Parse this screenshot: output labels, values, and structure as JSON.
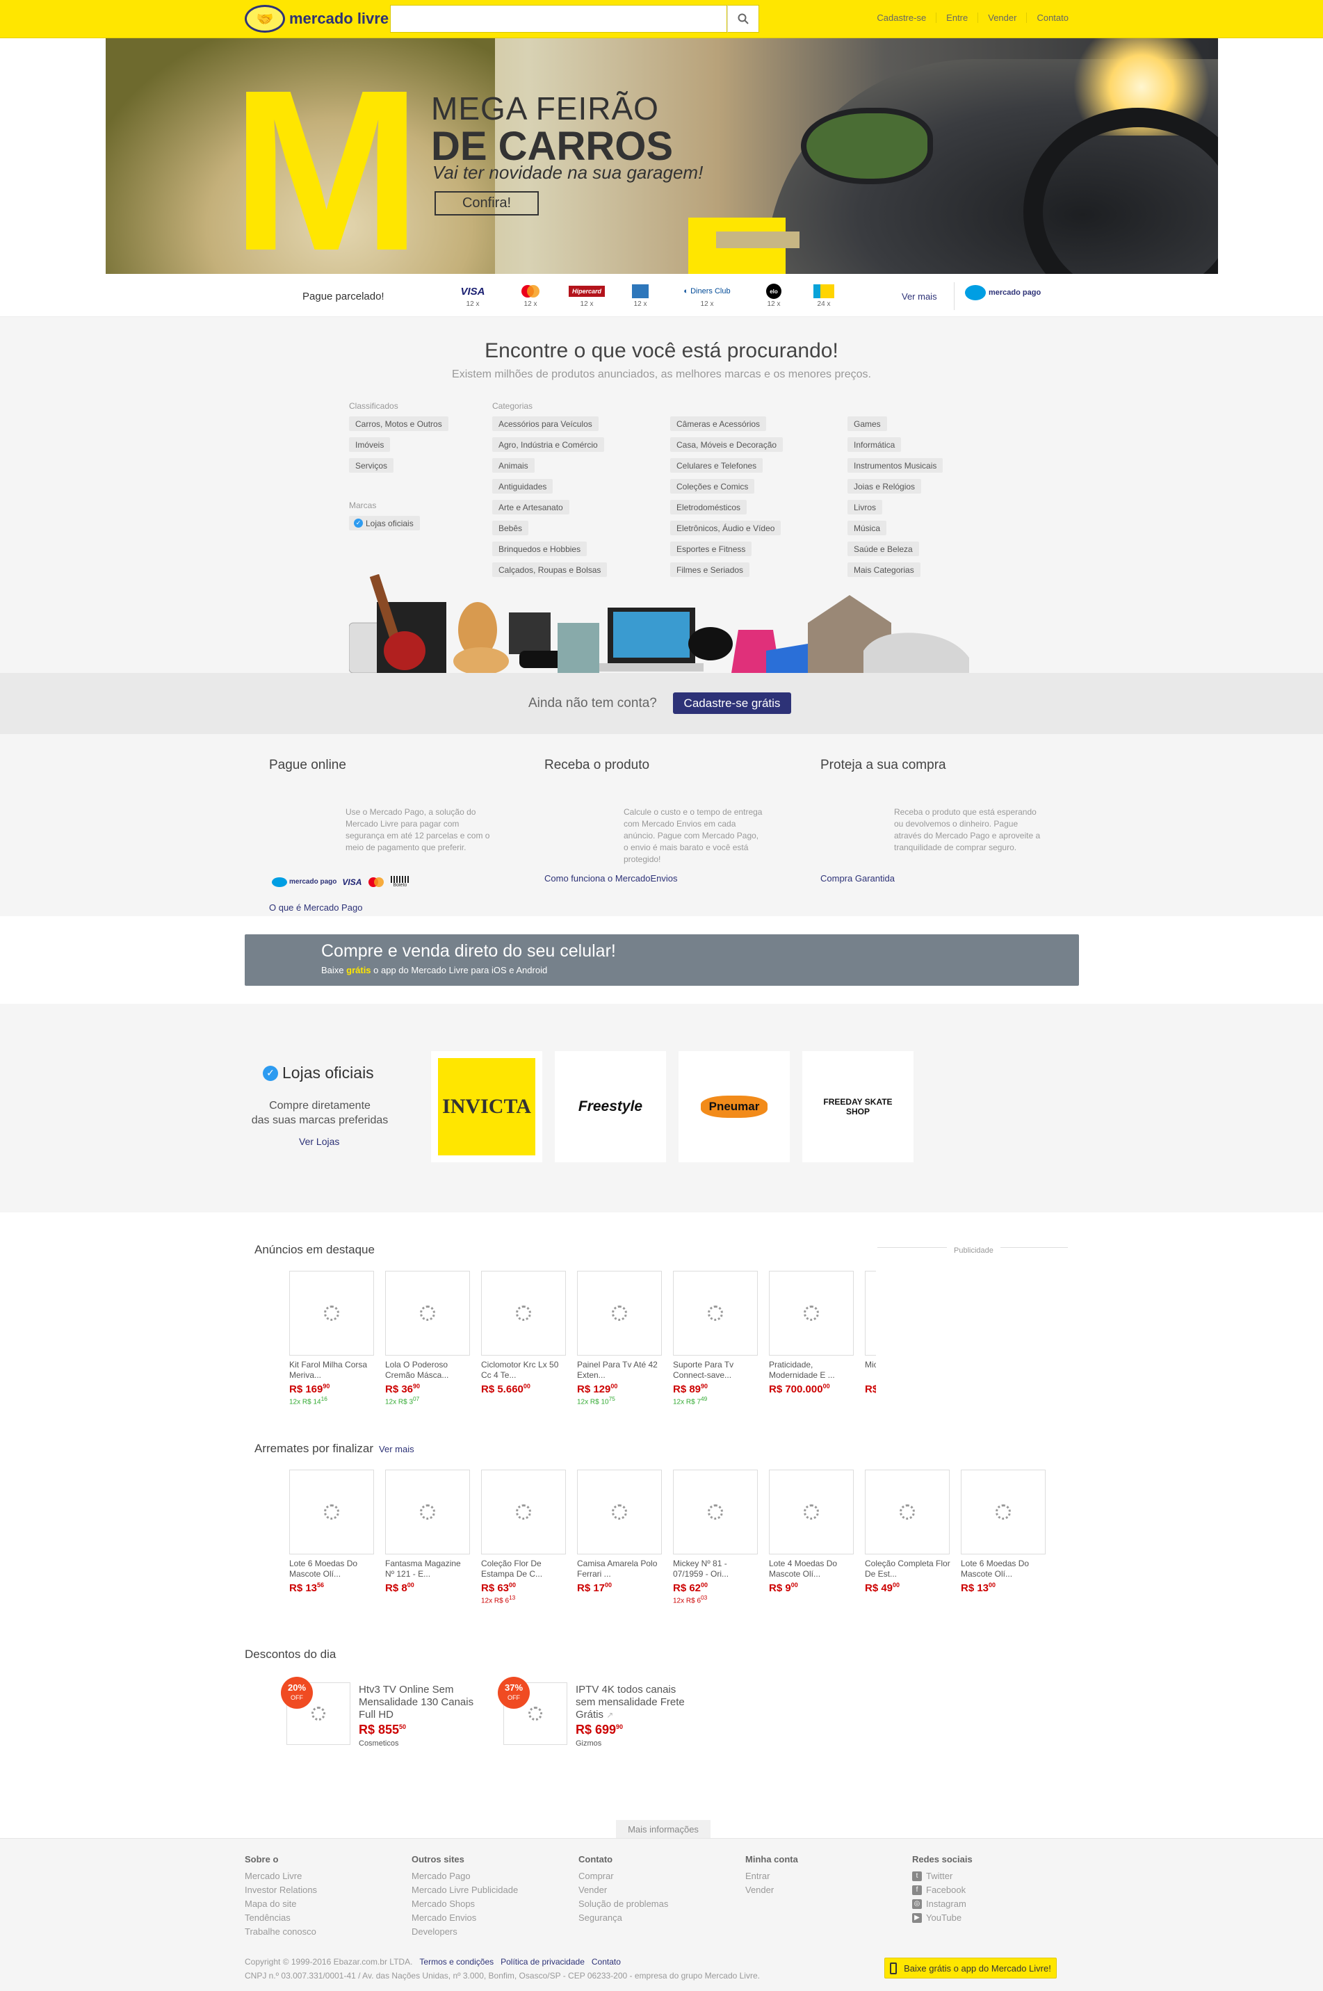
{
  "header": {
    "logo_text": "mercado livre",
    "search_placeholder": "",
    "nav": [
      "Cadastre-se",
      "Entre",
      "Vender",
      "Contato"
    ]
  },
  "banner": {
    "title1": "MEGA FEIRÃO",
    "title2": "DE CARROS",
    "subtitle": "Vai ter novidade na sua garagem!",
    "cta": "Confira!"
  },
  "payment": {
    "label": "Pague parcelado!",
    "cards": [
      {
        "name": "VISA",
        "installments": "12 x"
      },
      {
        "name": "mastercard",
        "installments": "12 x"
      },
      {
        "name": "Hipercard",
        "installments": "12 x"
      },
      {
        "name": "amex",
        "installments": "12 x"
      },
      {
        "name": "Diners Club",
        "installments": "12 x"
      },
      {
        "name": "elo",
        "installments": "12 x"
      },
      {
        "name": "card",
        "installments": "24 x"
      }
    ],
    "more": "Ver mais",
    "mp": "mercado pago"
  },
  "categories": {
    "title": "Encontre o que você está procurando!",
    "subtitle": "Existem milhões de produtos anunciados, as melhores marcas e os menores preços.",
    "classificados_title": "Classificados",
    "classificados": [
      "Carros, Motos e Outros",
      "Imóveis",
      "Serviços"
    ],
    "marcas_title": "Marcas",
    "marcas": [
      "Lojas oficiais"
    ],
    "categorias_title": "Categorias",
    "col1": [
      "Acessórios para Veículos",
      "Agro, Indústria e Comércio",
      "Animais",
      "Antiguidades",
      "Arte e Artesanato",
      "Bebês",
      "Brinquedos e Hobbies",
      "Calçados, Roupas e Bolsas"
    ],
    "col2": [
      "Câmeras e Acessórios",
      "Casa, Móveis e Decoração",
      "Celulares e Telefones",
      "Coleções e Comics",
      "Eletrodomésticos",
      "Eletrônicos, Áudio e Vídeo",
      "Esportes e Fitness",
      "Filmes e Seriados"
    ],
    "col3": [
      "Games",
      "Informática",
      "Instrumentos Musicais",
      "Joias e Relógios",
      "Livros",
      "Música",
      "Saúde e Beleza",
      "Mais Categorias"
    ]
  },
  "signup": {
    "question": "Ainda não tem conta?",
    "button": "Cadastre-se grátis"
  },
  "features": [
    {
      "title": "Pague online",
      "text": "Use o Mercado Pago, a solução do Mercado Livre para pagar com segurança em até 12 parcelas e com o meio de pagamento que preferir.",
      "link": "O que é Mercado Pago"
    },
    {
      "title": "Receba o produto",
      "text": "Calcule o custo e o tempo de entrega com Mercado Envios em cada anúncio. Pague com Mercado Pago, o envio é mais barato e você está protegido!",
      "link": "Como funciona o MercadoEnvios"
    },
    {
      "title": "Proteja a sua compra",
      "text": "Receba o produto que está esperando ou devolvemos o dinheiro. Pague através do Mercado Pago e aproveite a tranquilidade de comprar seguro.",
      "link": "Compra Garantida"
    }
  ],
  "feature_logos": {
    "mp": "mercado pago",
    "visa": "VISA",
    "boleto": "Boleto"
  },
  "app": {
    "title": "Compre e venda direto do seu celular!",
    "pre": "Baixe ",
    "free": "grátis",
    "post": " o app do Mercado Livre para iOS e Android"
  },
  "stores": {
    "title": "Lojas oficiais",
    "desc1": "Compre diretamente",
    "desc2": "das suas marcas preferidas",
    "link": "Ver Lojas",
    "brands": [
      "INVICTA",
      "Freestyle",
      "Pneumar",
      "FREEDAY SKATE SHOP"
    ]
  },
  "featured": {
    "title": "Anúncios em destaque",
    "pub": "Publicidade",
    "items": [
      {
        "name": "Kit Farol Milha Corsa Meriva...",
        "price": "R$ 169",
        "cents": "90",
        "inst": "12x R$ 14",
        "ic": "16"
      },
      {
        "name": "Lola O Poderoso Cremão Másca...",
        "price": "R$ 36",
        "cents": "90",
        "inst": "12x R$ 3",
        "ic": "07"
      },
      {
        "name": "Ciclomotor Krc Lx 50 Cc 4 Te...",
        "price": "R$ 5.660",
        "cents": "00",
        "inst": "",
        "ic": ""
      },
      {
        "name": "Painel Para Tv Até 42 Exten...",
        "price": "R$ 129",
        "cents": "00",
        "inst": "12x R$ 10",
        "ic": "75"
      },
      {
        "name": "Suporte Para Tv Connect-save...",
        "price": "R$ 89",
        "cents": "90",
        "inst": "12x R$ 7",
        "ic": "49"
      },
      {
        "name": "Praticidade, Modernidade E ...",
        "price": "R$ 700.000",
        "cents": "00",
        "inst": "",
        "ic": ""
      },
      {
        "name": "Mic Us...",
        "price": "R$",
        "cents": "",
        "inst": "",
        "ic": ""
      }
    ]
  },
  "auctions": {
    "title": "Arremates por finalizar",
    "link": "Ver mais",
    "items": [
      {
        "name": "Lote 6 Moedas Do Mascote Olí...",
        "price": "R$ 13",
        "cents": "56",
        "inst": "",
        "ic": ""
      },
      {
        "name": "Fantasma Magazine Nº 121 - E...",
        "price": "R$ 8",
        "cents": "00",
        "inst": "",
        "ic": ""
      },
      {
        "name": "Coleção Flor De Estampa De C...",
        "price": "R$ 63",
        "cents": "00",
        "inst": "12x R$ 6",
        "ic": "13"
      },
      {
        "name": "Camisa Amarela Polo Ferrari ...",
        "price": "R$ 17",
        "cents": "00",
        "inst": "",
        "ic": ""
      },
      {
        "name": "Mickey Nº 81 - 07/1959 - Ori...",
        "price": "R$ 62",
        "cents": "00",
        "inst": "12x R$ 6",
        "ic": "03"
      },
      {
        "name": "Lote 4 Moedas Do Mascote Olí...",
        "price": "R$ 9",
        "cents": "00",
        "inst": "",
        "ic": ""
      },
      {
        "name": "Coleção Completa Flor De Est...",
        "price": "R$ 49",
        "cents": "00",
        "inst": "",
        "ic": ""
      },
      {
        "name": "Lote 6 Moedas Do Mascote Olí...",
        "price": "R$ 13",
        "cents": "00",
        "inst": "",
        "ic": ""
      }
    ]
  },
  "discounts": {
    "title": "Descontos do dia",
    "items": [
      {
        "pct": "20%",
        "off": "OFF",
        "name": "Htv3 TV Online Sem Mensalidade 130 Canais Full HD",
        "price": "R$ 855",
        "cents": "50",
        "seller": "Cosmeticos"
      },
      {
        "pct": "37%",
        "off": "OFF",
        "name": "IPTV 4K todos canais sem mensalidade Frete Grátis",
        "price": "R$ 699",
        "cents": "90",
        "seller": "Gizmos"
      }
    ]
  },
  "footer": {
    "more": "Mais informações",
    "cols": [
      {
        "title": "Sobre o",
        "links": [
          "Mercado Livre",
          "Investor Relations",
          "Mapa do site",
          "Tendências",
          "Trabalhe conosco"
        ]
      },
      {
        "title": "Outros sites",
        "links": [
          "Mercado Pago",
          "Mercado Livre Publicidade",
          "Mercado Shops",
          "Mercado Envios",
          "Developers"
        ]
      },
      {
        "title": "Contato",
        "links": [
          "Comprar",
          "Vender",
          "Solução de problemas",
          "Segurança"
        ]
      },
      {
        "title": "Minha conta",
        "links": [
          "Entrar",
          "Vender"
        ]
      },
      {
        "title": "Redes sociais",
        "links": [
          "Twitter",
          "Facebook",
          "Instagram",
          "YouTube"
        ]
      }
    ],
    "copyright": "Copyright © 1999-2016 Ebazar.com.br LTDA.",
    "terms": "Termos e condições",
    "privacy": "Política de privacidade",
    "contact": "Contato",
    "address": "CNPJ n.º 03.007.331/0001-41 / Av. das Nações Unidas, nº 3.000, Bonfim, Osasco/SP - CEP 06233-200 - empresa do grupo Mercado Livre.",
    "app_button": "Baixe grátis o app do Mercado Livre!"
  }
}
